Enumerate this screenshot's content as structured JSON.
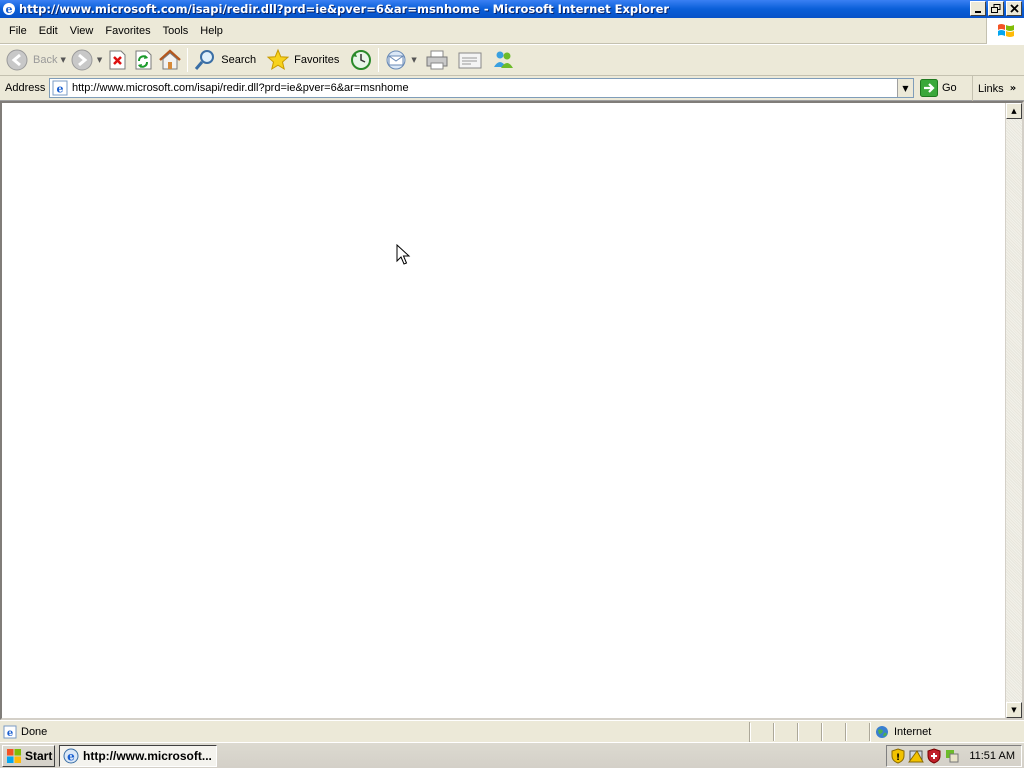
{
  "window": {
    "title": "http://www.microsoft.com/isapi/redir.dll?prd=ie&pver=6&ar=msnhome - Microsoft Internet Explorer"
  },
  "menu": [
    "File",
    "Edit",
    "View",
    "Favorites",
    "Tools",
    "Help"
  ],
  "toolbar": {
    "back_label": "Back",
    "search_label": "Search",
    "favorites_label": "Favorites"
  },
  "address": {
    "label": "Address",
    "url": "http://www.microsoft.com/isapi/redir.dll?prd=ie&pver=6&ar=msnhome",
    "go_label": "Go",
    "links_label": "Links"
  },
  "status": {
    "text": "Done",
    "zone": "Internet"
  },
  "taskbar": {
    "start_label": "Start",
    "task_label": "http://www.microsoft...",
    "clock": "11:51 AM"
  },
  "colors": {
    "titlebar": "#0a5fd8",
    "chrome": "#ece9d8",
    "content_bg": "#ffffff"
  }
}
